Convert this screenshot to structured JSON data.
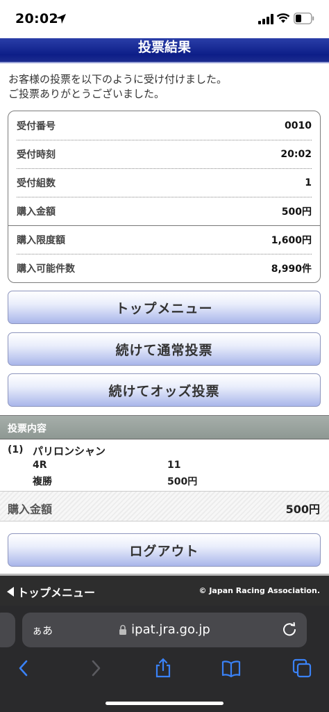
{
  "status": {
    "time": "20:02"
  },
  "header": {
    "title": "投票結果"
  },
  "message": {
    "line1": "お客様の投票を以下のように受け付けました。",
    "line2": "ご投票ありがとうございました。"
  },
  "receipt": [
    {
      "label": "受付番号",
      "value": "0010"
    },
    {
      "label": "受付時刻",
      "value": "20:02"
    },
    {
      "label": "受付組数",
      "value": "1"
    },
    {
      "label": "購入金額",
      "value": "500円"
    },
    {
      "label": "購入限度額",
      "value": "1,600円"
    },
    {
      "label": "購入可能件数",
      "value": "8,990件"
    }
  ],
  "buttons": {
    "top_menu": "トップメニュー",
    "continue_normal": "続けて通常投票",
    "continue_odds": "続けてオッズ投票",
    "logout": "ログアウト"
  },
  "vote_section": {
    "title": "投票内容",
    "items": [
      {
        "index": "(1)",
        "horse": "パリロンシャン",
        "race": "4R",
        "number": "11",
        "bet_type": "複勝",
        "amount": "500円"
      }
    ]
  },
  "total": {
    "label": "購入金額",
    "value": "500円"
  },
  "footer": {
    "link": "トップメニュー",
    "copyright": "© Japan Racing Association."
  },
  "browser": {
    "aa": "ぁあ",
    "url": "ipat.jra.go.jp"
  },
  "colors": {
    "header_blue": "#0d1e88",
    "button_gradient_end": "#a9b6ea",
    "section_gray": "#9aa29e",
    "safari_bg": "#2a2a2c",
    "ios_blue": "#3a82f7"
  }
}
